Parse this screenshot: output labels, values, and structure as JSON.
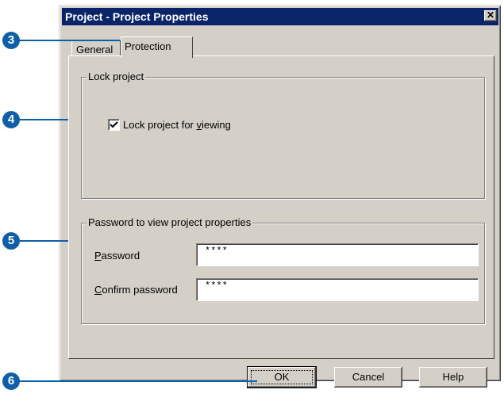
{
  "dialog": {
    "title": "Project - Project Properties",
    "close_glyph": "✕"
  },
  "tabs": [
    {
      "label": "General",
      "active": false
    },
    {
      "label": "Protection",
      "active": true
    }
  ],
  "lock_group": {
    "legend": "Lock project",
    "checkbox_label_before": "Lock project for ",
    "checkbox_label_accel": "v",
    "checkbox_label_after": "iewing",
    "checked": true
  },
  "password_group": {
    "legend": "Password to view project properties",
    "password_label_accel": "P",
    "password_label_rest": "assword",
    "password_value": "****",
    "confirm_label_accel": "C",
    "confirm_label_rest": "onfirm password",
    "confirm_value": "****"
  },
  "buttons": {
    "ok": "OK",
    "cancel": "Cancel",
    "help": "Help"
  },
  "callouts": [
    "3",
    "4",
    "5",
    "6"
  ],
  "colors": {
    "callout": "#0f5fa8",
    "titlebar": "#0a246a",
    "dialog_face": "#d4d0c8"
  }
}
